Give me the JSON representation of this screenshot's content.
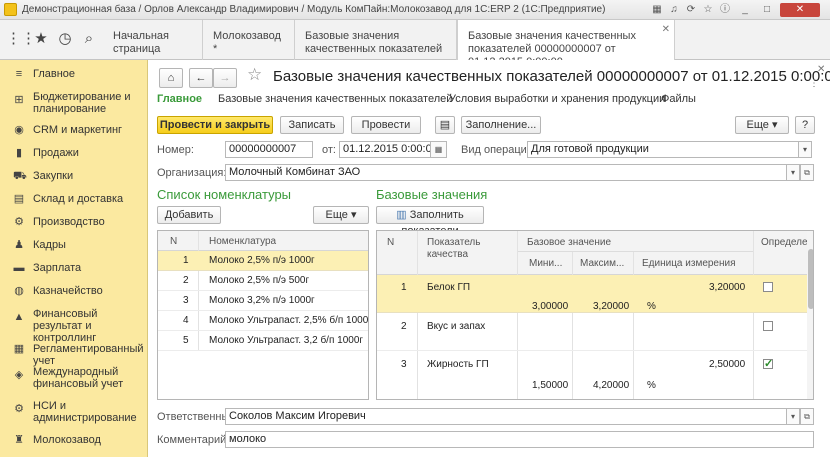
{
  "window": {
    "title": "Демонстрационная база / Орлов Александр Владимирович / Модуль КомПайн:Молокозавод для 1С:ERP 2  (1С:Предприятие)"
  },
  "tabs": [
    {
      "label": "Начальная страница"
    },
    {
      "label": "Молокозавод *"
    },
    {
      "label": "Базовые значения качественных показателей"
    },
    {
      "label": "Базовые значения качественных показателей 00000000007 от 01.12.2015 0:00:00"
    }
  ],
  "sidebar": {
    "items": [
      {
        "label": "Главное",
        "icon": "menu-icon"
      },
      {
        "label": "Бюджетирование и планирование",
        "icon": "budget-icon"
      },
      {
        "label": "CRM и маркетинг",
        "icon": "crm-icon"
      },
      {
        "label": "Продажи",
        "icon": "sales-icon"
      },
      {
        "label": "Закупки",
        "icon": "purchase-icon"
      },
      {
        "label": "Склад и доставка",
        "icon": "warehouse-icon"
      },
      {
        "label": "Производство",
        "icon": "production-icon"
      },
      {
        "label": "Кадры",
        "icon": "staff-icon"
      },
      {
        "label": "Зарплата",
        "icon": "salary-icon"
      },
      {
        "label": "Казначейство",
        "icon": "treasury-icon"
      },
      {
        "label": "Финансовый результат и контроллинг",
        "icon": "finance-icon"
      },
      {
        "label": "Регламентированный учет",
        "icon": "accounting-icon"
      },
      {
        "label": "Международный финансовый учет",
        "icon": "intl-icon"
      },
      {
        "label": "НСИ и администрирование",
        "icon": "admin-icon"
      },
      {
        "label": "Молокозавод",
        "icon": "dairy-icon"
      }
    ]
  },
  "doc": {
    "title": "Базовые значения качественных показателей 00000000007 от 01.12.2015 0:00:00",
    "nav": [
      "Главное",
      "Базовые значения качественных показателей",
      "Условия выработки и хранения продукции",
      "Файлы"
    ],
    "toolbar": {
      "post_close": "Провести и закрыть",
      "save": "Записать",
      "post": "Провести",
      "fill": "Заполнение...",
      "more": "Еще",
      "help": "?"
    },
    "fields": {
      "number_label": "Номер:",
      "number_value": "00000000007",
      "date_label": "от:",
      "date_value": "01.12.2015  0:00:00",
      "operation_label": "Вид операции:",
      "operation_value": "Для готовой продукции",
      "org_label": "Организация:",
      "org_value": "Молочный Комбинат ЗАО",
      "responsible_label": "Ответственный:",
      "responsible_value": "Соколов Максим Игоревич",
      "comment_label": "Комментарий:",
      "comment_value": "молоко"
    }
  },
  "left_panel": {
    "title": "Список номенклатуры",
    "add": "Добавить",
    "more": "Еще",
    "columns": [
      "N",
      "Номенклатура"
    ],
    "rows": [
      {
        "n": "1",
        "name": "Молоко  2,5% п/э  1000г"
      },
      {
        "n": "2",
        "name": "Молоко  2,5% п/э  500г"
      },
      {
        "n": "3",
        "name": "Молоко  3,2% п/э 1000г"
      },
      {
        "n": "4",
        "name": "Молоко Ультрапаст. 2,5% б/п 1000г"
      },
      {
        "n": "5",
        "name": "Молоко Ультрапаст. 3,2 б/п 1000г"
      }
    ]
  },
  "right_panel": {
    "title": "Базовые значения",
    "fill": "Заполнить показатели",
    "columns": {
      "n": "N",
      "indicator": "Показатель качества",
      "base": "Базовое значение",
      "min": "Мини...",
      "max": "Максим...",
      "unit": "Единица измерения",
      "def": "Определе"
    },
    "rows": [
      {
        "n": "1",
        "indicator": "Белок ГП",
        "value": "3,20000",
        "min": "3,00000",
        "max": "3,20000",
        "unit": "%",
        "checked": false
      },
      {
        "n": "2",
        "indicator": "Вкус и запах",
        "value": "",
        "min": "",
        "max": "",
        "unit": "",
        "checked": false
      },
      {
        "n": "3",
        "indicator": "Жирность ГП",
        "value": "2,50000",
        "min": "1,50000",
        "max": "4,20000",
        "unit": "%",
        "checked": true
      }
    ]
  },
  "colors": {
    "sidebar": "#fbe9a0",
    "primary_button": "#f6cd1c",
    "selection": "#fcf0b4",
    "section_title": "#3a9a3a"
  }
}
